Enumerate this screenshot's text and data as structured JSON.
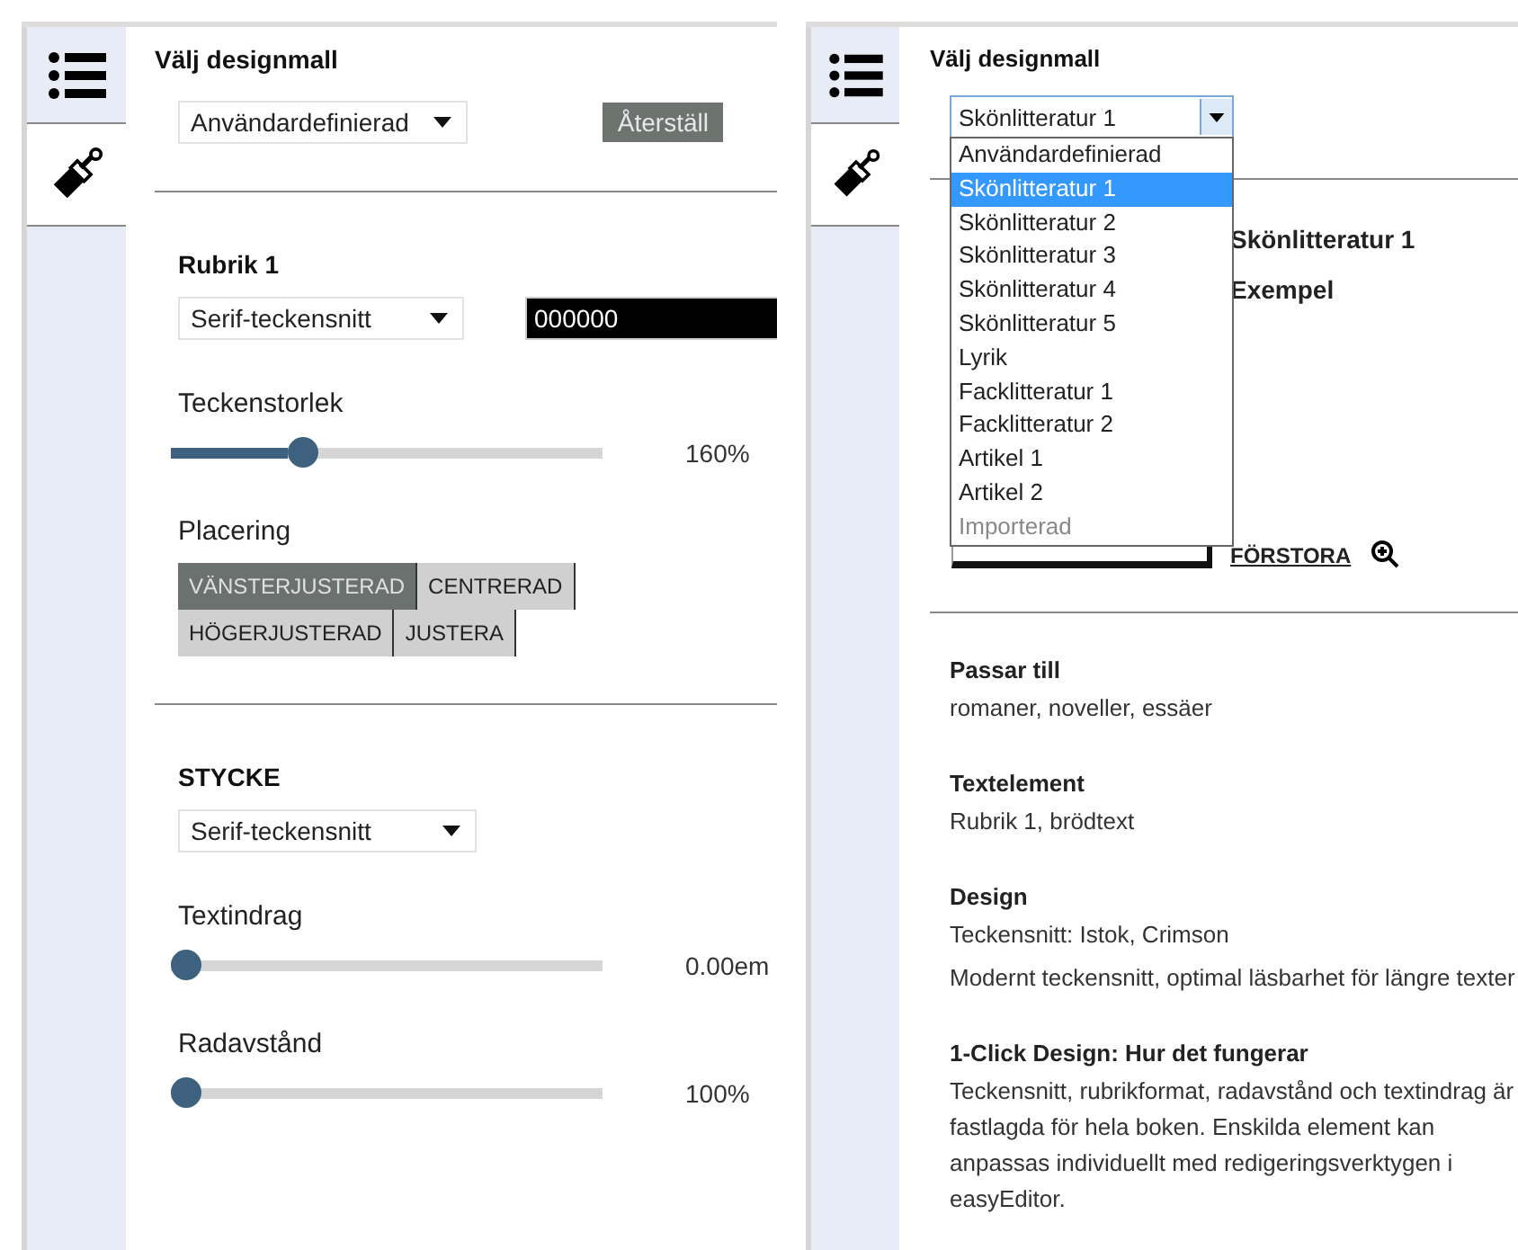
{
  "left_panel": {
    "tabs": [
      {
        "kind": "list",
        "selected": false
      },
      {
        "kind": "brush",
        "selected": true
      }
    ],
    "template_label": "Välj designmall",
    "template_select": "Användardefinierad",
    "reset_button": "Återställ",
    "sections": [
      {
        "title": "Rubrik 1",
        "font_select": "Serif-teckensnitt",
        "color_value": "000000",
        "sliders": [
          {
            "label": "Teckenstorlek",
            "level": 0.29,
            "reading": "160%"
          }
        ],
        "alignment": {
          "label": "Placering",
          "options": [
            {
              "label": "VÄNSTERJUSTERAD",
              "selected": true
            },
            {
              "label": "CENTRERAD",
              "selected": false
            },
            {
              "label": "HÖGERJUSTERAD",
              "selected": false
            },
            {
              "label": "JUSTERA",
              "selected": false
            }
          ]
        }
      },
      {
        "title": "STYCKE",
        "font_select": "Serif-teckensnitt",
        "sliders": [
          {
            "label": "Textindrag",
            "level": 0,
            "reading": "0.00em"
          },
          {
            "label": "Radavstånd",
            "level": 0,
            "reading": "100%"
          }
        ]
      }
    ]
  },
  "right_panel": {
    "tabs": [
      {
        "kind": "list",
        "selected": false
      },
      {
        "kind": "brush",
        "selected": true
      }
    ],
    "template_label": "Välj designmall",
    "template_select": "Skönlitteratur 1",
    "dropdown_options": [
      {
        "label": "Användardefinierad",
        "selected": false,
        "disabled": false
      },
      {
        "label": "Skönlitteratur 1",
        "selected": true,
        "disabled": false
      },
      {
        "label": "Skönlitteratur 2",
        "selected": false,
        "disabled": false
      },
      {
        "label": "Skönlitteratur 3",
        "selected": false,
        "disabled": false
      },
      {
        "label": "Skönlitteratur 4",
        "selected": false,
        "disabled": false
      },
      {
        "label": "Skönlitteratur 5",
        "selected": false,
        "disabled": false
      },
      {
        "label": "Lyrik",
        "selected": false,
        "disabled": false
      },
      {
        "label": "Facklitteratur 1",
        "selected": false,
        "disabled": false
      },
      {
        "label": "Facklitteratur 2",
        "selected": false,
        "disabled": false
      },
      {
        "label": "Artikel 1",
        "selected": false,
        "disabled": false
      },
      {
        "label": "Artikel 2",
        "selected": false,
        "disabled": false
      },
      {
        "label": "Importerad",
        "selected": false,
        "disabled": true
      }
    ],
    "preview_title": "Skönlitteratur 1",
    "preview_subtitle": "Exempel",
    "zoom_link": "FÖRSTORA",
    "info": [
      {
        "heading": "Passar till",
        "paragraphs": [
          "romaner, noveller, essäer"
        ]
      },
      {
        "heading": "Textelement",
        "paragraphs": [
          "Rubrik 1, brödtext"
        ]
      },
      {
        "heading": "Design",
        "paragraphs": [
          "Teckensnitt: Istok, Crimson",
          "Modernt teckensnitt, optimal läsbarhet för längre texter"
        ]
      },
      {
        "heading": "1-Click Design: Hur det fungerar",
        "paragraphs": [
          "Teckensnitt, rubrikformat, radavstånd och textindrag är fastlagda för hela boken. Enskilda element kan anpassas individuellt med redigeringsverktygen i easyEditor."
        ]
      }
    ]
  }
}
